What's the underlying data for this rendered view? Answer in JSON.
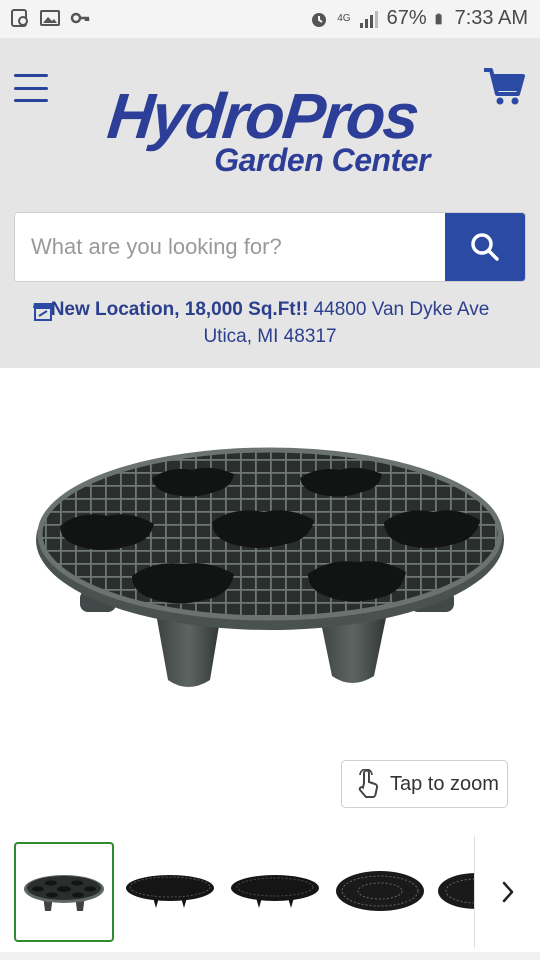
{
  "status_bar": {
    "battery": "67%",
    "time": "7:33 AM",
    "network": "4G"
  },
  "header": {
    "logo_main": "HydroPros",
    "logo_sub": "Garden Center"
  },
  "search": {
    "placeholder": "What are you looking for?"
  },
  "store_notice": {
    "highlight": "New Location, 18,000 Sq.Ft!!",
    "address_line1": "44800 Van Dyke Ave",
    "address_line2": "Utica, MI 48317"
  },
  "product": {
    "zoom_label": "Tap to zoom"
  },
  "colors": {
    "brand_blue": "#2c3e97",
    "header_bg": "#e5e5e5",
    "active_thumb_border": "#2e8b2e"
  },
  "icons": [
    "hamburger-menu-icon",
    "cart-icon",
    "search-icon",
    "store-icon",
    "touch-icon",
    "chevron-right-icon"
  ]
}
